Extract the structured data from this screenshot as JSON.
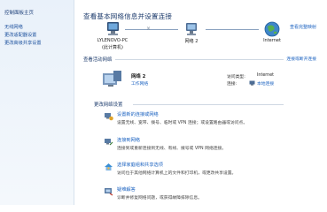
{
  "sidebar": {
    "title": "控制面板主页",
    "links": [
      "无线网络",
      "更改适配器设置",
      "更改高级共享设置"
    ]
  },
  "header": {
    "title": "查看基本网络信息并设置连接",
    "full_map_link": "查看完整映射"
  },
  "network_map": {
    "computer_label": "LYLENOVO-PC",
    "computer_sub": "(此计算机)",
    "network_label": "网络 2",
    "internet_label": "Internet"
  },
  "active": {
    "heading": "查看活动网络",
    "link": "连接或断开连接",
    "network_name": "网络 2",
    "network_type": "工作网络",
    "access_type_label": "访问类型:",
    "access_type_value": "Internet",
    "connections_label": "连接:",
    "connections_value": "本地连接"
  },
  "tasks": {
    "heading": "更改网络设置",
    "items": [
      {
        "title": "设置新的连接或网络",
        "desc": "设置无线、宽带、拨号、临时或 VPN 连接；或设置路由器或访问点。",
        "icon": "new-connection-icon"
      },
      {
        "title": "连接到网络",
        "desc": "连接到或重新连接到无线、有线、拨号或 VPN 网络连接。",
        "icon": "connect-network-icon"
      },
      {
        "title": "选择家庭组和共享选项",
        "desc": "访问位于其他网络计算机上的文件和打印机，或更改共享设置。",
        "icon": "homegroup-icon"
      },
      {
        "title": "疑难解答",
        "desc": "诊断并修复网络问题，或获得故障排除信息。",
        "icon": "troubleshoot-icon"
      }
    ]
  }
}
